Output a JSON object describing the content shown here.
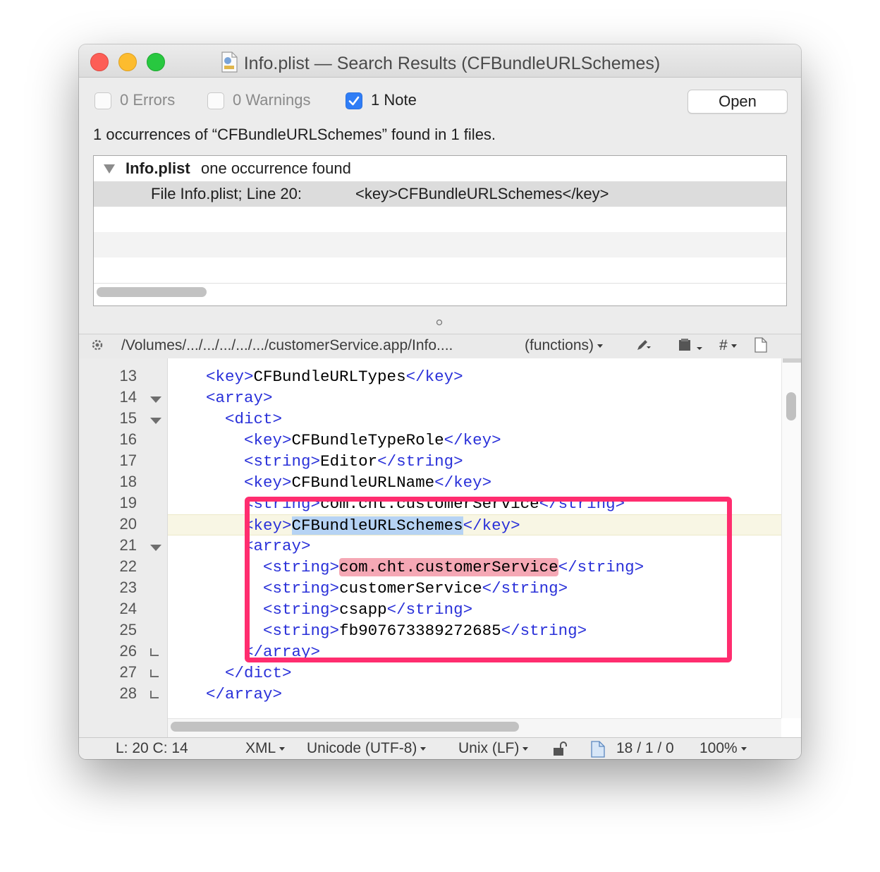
{
  "window": {
    "title": "Info.plist — Search Results (CFBundleURLSchemes)"
  },
  "filters": {
    "errors": "0 Errors",
    "warnings": "0 Warnings",
    "notes": "1 Note",
    "errors_checked": false,
    "warnings_checked": false,
    "notes_checked": true,
    "open_button": "Open"
  },
  "summary": "1 occurrences of “CFBundleURLSchemes” found in 1 files.",
  "results": {
    "file_name": "Info.plist",
    "file_desc": "one occurrence found",
    "hit_location": "File Info.plist; Line 20:",
    "hit_code": "<key>CFBundleURLSchemes</key>"
  },
  "navbar": {
    "path": "/Volumes/.../.../.../.../.../customerService.app/Info....",
    "functions": "(functions)",
    "icons": [
      "gear-icon",
      "pencil-icon",
      "clipboard-icon",
      "hash-icon",
      "document-icon"
    ]
  },
  "editor": {
    "line_numbers": [
      "13",
      "14",
      "15",
      "16",
      "17",
      "18",
      "19",
      "20",
      "21",
      "22",
      "23",
      "24",
      "25",
      "26",
      "27",
      "28"
    ],
    "lines": [
      "<key>CFBundleURLTypes</key>",
      "<array>",
      "<dict>",
      "<key>CFBundleTypeRole</key>",
      "<string>Editor</string>",
      "<key>CFBundleURLName</key>",
      "<string>com.cht.customerService</string>",
      "<key>CFBundleURLSchemes</key>",
      "<array>",
      "<string>com.cht.customerService</string>",
      "<string>customerService</string>",
      "<string>csapp</string>",
      "<string>fb907673389272685</string>",
      "</array>",
      "</dict>",
      "</array>"
    ]
  },
  "status": {
    "position": "L: 20 C: 14",
    "language": "XML",
    "encoding": "Unicode (UTF-8)",
    "line_endings": "Unix (LF)",
    "counts": "18 / 1 / 0",
    "zoom": "100%"
  },
  "colors": {
    "tag": "#2930d9",
    "highlight_box": "#ff2d6f",
    "selection": "#b6d3f4",
    "match": "#f5a8b5"
  }
}
